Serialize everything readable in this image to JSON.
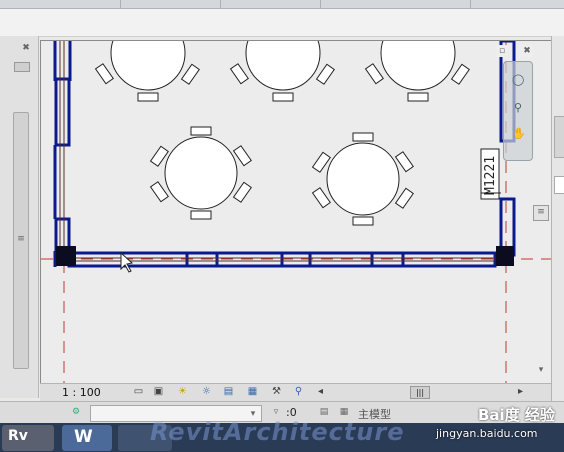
{
  "top_toolbar": {
    "visible": true
  },
  "left_panel": {
    "close_glyph": "✖",
    "grip_glyph": "≡"
  },
  "view": {
    "door_tag": "M1221",
    "scale": "1 : 100",
    "close_glyph": "✖",
    "grip_glyph": "≡",
    "arrow_left": "◂",
    "arrow_right": "▸",
    "arrow_down": "▾",
    "hscroll_thumb": "|||"
  },
  "view_controls": {
    "icons": [
      "detail-level-icon",
      "visual-style-icon",
      "sun-path-icon",
      "shadows-icon",
      "crop-view-icon",
      "show-crop-icon",
      "temporary-hide-icon",
      "reveal-hidden-icon"
    ]
  },
  "status": {
    "workset_value": "",
    "filter_value": ":0",
    "model_name": "主模型"
  },
  "taskbar": {
    "app1": "Rv",
    "app2": "W",
    "watermark": "RevitArchitecture",
    "baidu_brand": "Bai度 经验",
    "baidu_url": "jingyan.baidu.com"
  },
  "colors": {
    "wall_outline": "#0a1a8c",
    "grid_red": "#c0392b",
    "background": "#ececec"
  }
}
